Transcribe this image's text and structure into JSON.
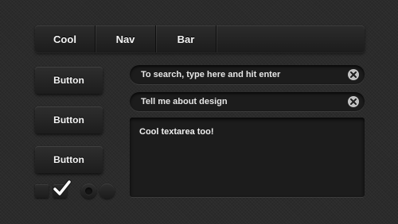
{
  "nav": {
    "items": [
      {
        "label": "Cool"
      },
      {
        "label": "Nav"
      },
      {
        "label": "Bar"
      }
    ]
  },
  "buttons": [
    {
      "label": "Button"
    },
    {
      "label": "Button"
    },
    {
      "label": "Button"
    }
  ],
  "search": {
    "placeholder": "To search, type here and hit enter",
    "clear_icon": "close-circle-icon"
  },
  "text_input": {
    "value": "Tell me about design",
    "clear_icon": "close-circle-icon"
  },
  "textarea": {
    "value": "Cool textarea too!"
  },
  "checkboxes": [
    {
      "checked": false
    },
    {
      "checked": true,
      "icon": "checkmark-icon"
    }
  ],
  "radios": [
    {
      "selected": true
    },
    {
      "selected": false
    }
  ],
  "colors": {
    "background": "#2b2b2b",
    "control": "#1c1c1c",
    "text": "#f2f2f2",
    "clear_icon": "#c2c2c2"
  }
}
